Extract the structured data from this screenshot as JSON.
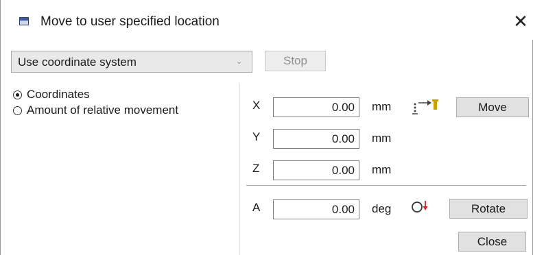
{
  "dialog": {
    "title": "Move to user specified location",
    "icons": {
      "app": "window-icon",
      "close": "close-icon"
    }
  },
  "toolbar": {
    "mode_select": {
      "selected": "Use coordinate system"
    },
    "stop_label": "Stop"
  },
  "options": [
    {
      "label": "Coordinates",
      "checked": true
    },
    {
      "label": "Amount of relative movement",
      "checked": false
    }
  ],
  "position": {
    "x": {
      "label": "X",
      "value": "0.00",
      "unit": "mm"
    },
    "y": {
      "label": "Y",
      "value": "0.00",
      "unit": "mm"
    },
    "z": {
      "label": "Z",
      "value": "0.00",
      "unit": "mm"
    },
    "move_label": "Move",
    "move_icon": "move-tool-icon"
  },
  "rotation": {
    "a": {
      "label": "A",
      "value": "0.00",
      "unit": "deg"
    },
    "rotate_label": "Rotate",
    "rotate_icon": "rotate-icon"
  },
  "footer": {
    "close_label": "Close"
  }
}
